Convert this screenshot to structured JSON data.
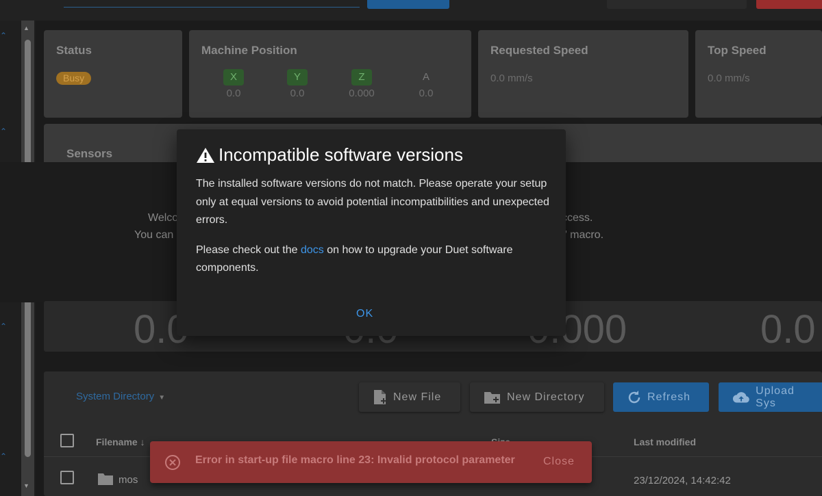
{
  "status_card": {
    "title": "Status",
    "badge": "Busy"
  },
  "machine_position": {
    "title": "Machine Position",
    "axes": [
      {
        "letter": "X",
        "value": "0.0",
        "homed": true
      },
      {
        "letter": "Y",
        "value": "0.0",
        "homed": true
      },
      {
        "letter": "Z",
        "value": "0.000",
        "homed": true
      },
      {
        "letter": "A",
        "value": "0.0",
        "homed": false
      }
    ]
  },
  "requested_speed": {
    "title": "Requested Speed",
    "value": "0.0 mm/s"
  },
  "top_speed": {
    "title": "Top Speed",
    "value": "0.0 mm/s"
  },
  "sensors": {
    "title": "Sensors"
  },
  "background_text": {
    "line1_left": "Welco",
    "line2_left": "You can",
    "line1_right": "ccess.",
    "line2_right": "\" macro."
  },
  "big_values": [
    "0.0",
    "0.0",
    "0.000",
    "0.0"
  ],
  "files": {
    "directory_select": "System Directory",
    "new_file_label": "New File",
    "new_directory_label": "New Directory",
    "refresh_label": "Refresh",
    "upload_label": "Upload Sys",
    "columns": {
      "filename": "Filename",
      "size": "Size",
      "last_modified": "Last modified"
    },
    "rows": [
      {
        "name": "mos",
        "last_modified": "23/12/2024, 14:42:42"
      }
    ]
  },
  "dialog": {
    "title": "Incompatible software versions",
    "body_p1": "The installed software versions do not match. Please operate your setup only at equal versions to avoid potential incompatibilities and unexpected errors.",
    "body_p2_before": "Please check out the ",
    "body_p2_link": "docs",
    "body_p2_after": " on how to upgrade your Duet software components.",
    "ok_label": "OK"
  },
  "snackbar": {
    "message": "Error in start-up file macro line 23: Invalid protocol parameter",
    "close_label": "Close"
  },
  "colors": {
    "accent": "#3d95e8",
    "error": "#8e3333",
    "busy": "#a07122",
    "homed": "#2f5b2d"
  }
}
